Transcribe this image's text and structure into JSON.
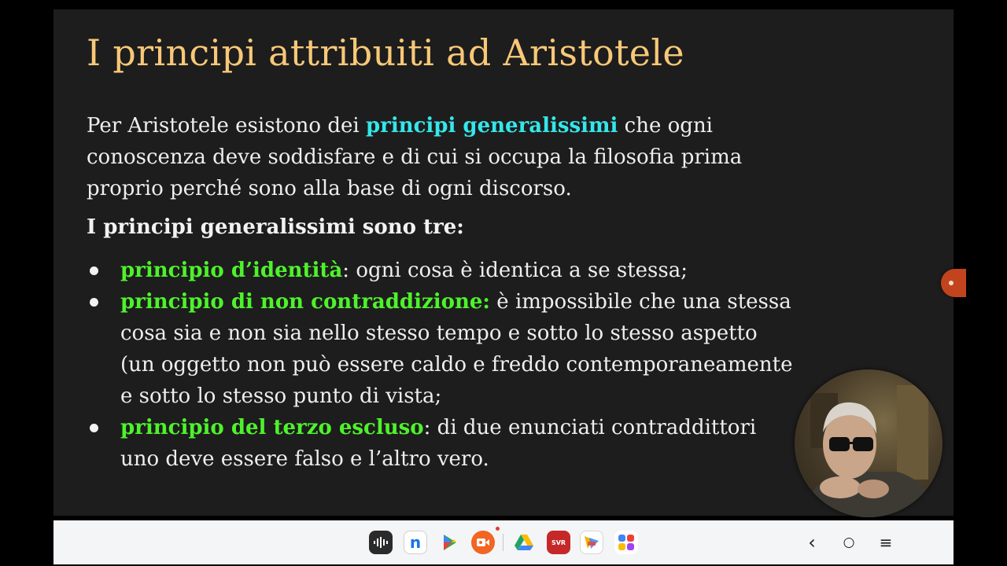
{
  "slide": {
    "title": "I principi attribuiti ad Aristotele",
    "intro": {
      "before": "Per Aristotele esistono dei ",
      "highlight": "principi generalissimi",
      "after": " che ogni conoscenza deve soddisfare e di cui si occupa la filosofia prima proprio perché sono alla base di ogni discorso."
    },
    "subheading": "I principi generalissimi sono tre:",
    "principles": [
      {
        "name": "principio d’identità",
        "text": ": ogni cosa è identica a se stessa;"
      },
      {
        "name": "principio di non contraddizione:",
        "text": " è impossibile che una stessa cosa sia e non sia nello stesso tempo e sotto lo stesso aspetto (un oggetto non può essere caldo e freddo contemporaneamente e sotto lo stesso punto di vista;"
      },
      {
        "name": "principio del terzo escluso",
        "text": ": di due enunciati contraddittori uno deve essere falso e l’altro vero."
      }
    ]
  },
  "colors": {
    "title": "#f7c878",
    "cyan_highlight": "#35e6ea",
    "green_highlight": "#4ef22c",
    "slide_background": "#1d1d1d",
    "taskbar_background": "#f4f5f7"
  },
  "taskbar": {
    "apps": [
      {
        "icon": "audio-recorder-icon"
      },
      {
        "icon": "notion-icon",
        "label": "n"
      },
      {
        "icon": "play-store-icon"
      },
      {
        "icon": "screen-recorder-icon"
      },
      {
        "icon": "google-drive-icon"
      },
      {
        "icon": "svr-recorder-icon",
        "label": "SVR"
      },
      {
        "icon": "photo-editor-icon"
      },
      {
        "icon": "app-drawer-icon"
      }
    ],
    "nav": [
      {
        "icon": "back-icon",
        "glyph": "‹"
      },
      {
        "icon": "home-icon",
        "glyph": "○"
      },
      {
        "icon": "recents-icon",
        "glyph": "≡"
      }
    ]
  }
}
